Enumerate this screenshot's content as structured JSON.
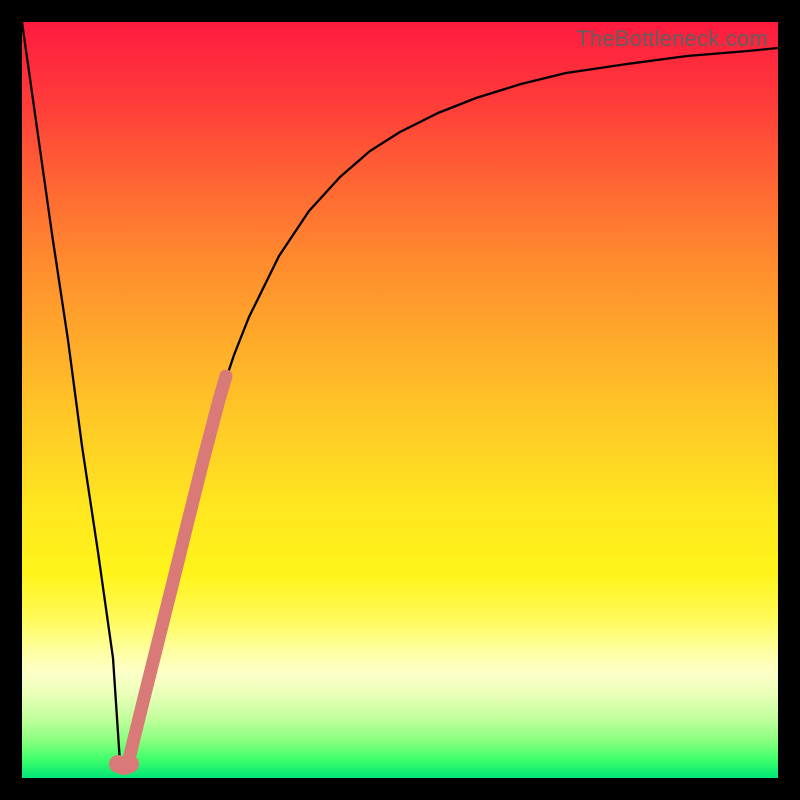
{
  "watermark": "TheBottleneck.com",
  "colors": {
    "frame": "#000000",
    "curve_stroke": "#000000",
    "highlight_stroke": "#d97a78",
    "gradient_top": "#ff1a3f",
    "gradient_bottom": "#00e676"
  },
  "chart_data": {
    "type": "line",
    "title": "",
    "xlabel": "",
    "ylabel": "",
    "xlim": [
      0,
      100
    ],
    "ylim": [
      0,
      100
    ],
    "grid": false,
    "legend": false,
    "series": [
      {
        "name": "bottleneck_curve",
        "x": [
          0,
          2,
          4,
          6,
          8,
          10,
          12,
          13,
          14,
          16,
          18,
          20,
          22,
          24,
          26,
          28,
          30,
          34,
          38,
          42,
          46,
          50,
          55,
          60,
          66,
          72,
          80,
          88,
          96,
          100
        ],
        "y": [
          100,
          86,
          72,
          58,
          44,
          30,
          16,
          2,
          2,
          10,
          18,
          26,
          34,
          42,
          50,
          56,
          61,
          69,
          75,
          79.5,
          83,
          85.5,
          88,
          90,
          91.8,
          93.2,
          94.5,
          95.5,
          96.2,
          96.5
        ]
      },
      {
        "name": "highlight_segment",
        "x": [
          14,
          16,
          18,
          20,
          22,
          24,
          26,
          27
        ],
        "y": [
          2,
          10,
          18,
          26,
          34,
          42,
          50,
          53
        ]
      },
      {
        "name": "minimum_marker",
        "x": [
          13
        ],
        "y": [
          2
        ]
      }
    ],
    "annotations": []
  }
}
